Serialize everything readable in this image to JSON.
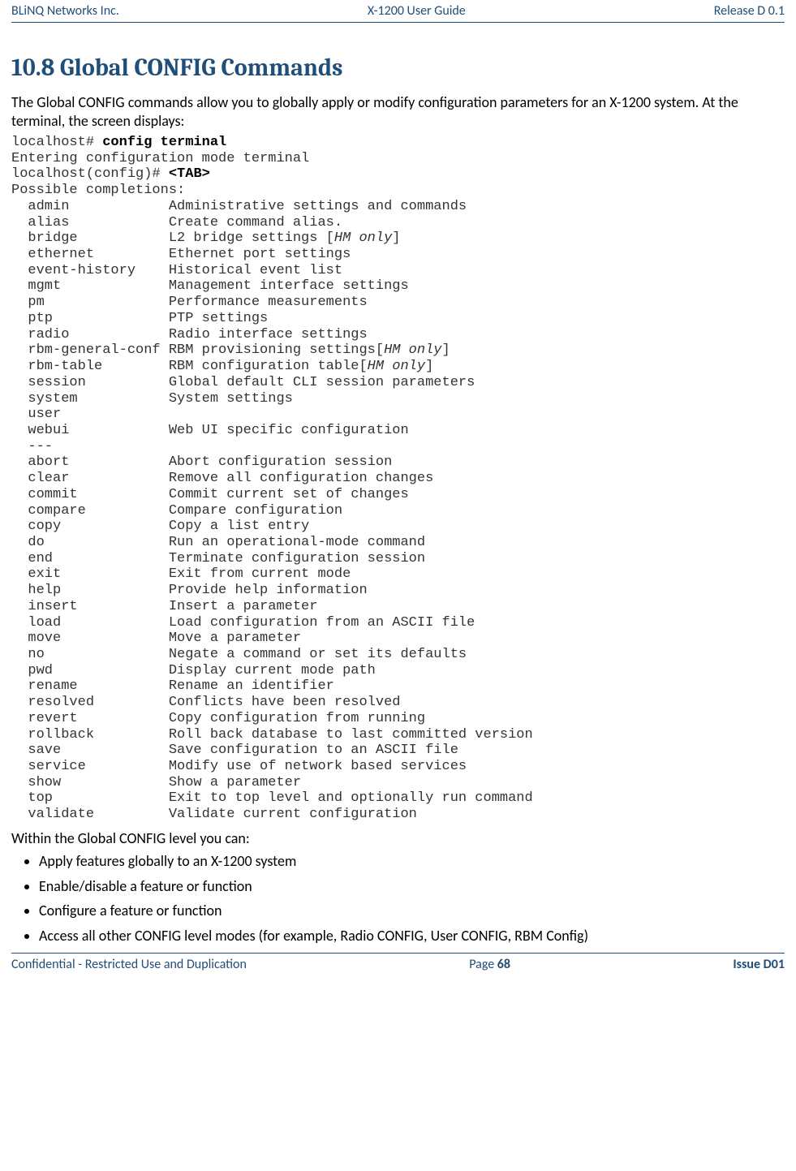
{
  "header": {
    "left": "BLiNQ Networks Inc.",
    "center": "X-1200 User Guide",
    "right": "Release D 0.1"
  },
  "section": {
    "title": "10.8 Global CONFIG Commands",
    "intro": "The Global CONFIG commands allow you to globally apply or modify configuration parameters for an X-1200 system. At the terminal, the screen displays:"
  },
  "terminal": {
    "line1_prefix": "localhost# ",
    "line1_bold": "config terminal",
    "line2": "Entering configuration mode terminal",
    "line3_prefix": "localhost(config)# ",
    "line3_bold": "<TAB>",
    "line4": "Possible completions:",
    "completions": [
      {
        "cmd": "admin",
        "desc": "Administrative settings and commands"
      },
      {
        "cmd": "alias",
        "desc": "Create command alias."
      },
      {
        "cmd": "bridge",
        "desc": "L2 bridge settings [",
        "italic": "HM only",
        "desc_after": "]"
      },
      {
        "cmd": "ethernet",
        "desc": "Ethernet port settings"
      },
      {
        "cmd": "event-history",
        "desc": "Historical event list"
      },
      {
        "cmd": "mgmt",
        "desc": "Management interface settings"
      },
      {
        "cmd": "pm",
        "desc": "Performance measurements"
      },
      {
        "cmd": "ptp",
        "desc": "PTP settings"
      },
      {
        "cmd": "radio",
        "desc": "Radio interface settings"
      },
      {
        "cmd": "rbm-general-conf",
        "desc": "RBM provisioning settings[",
        "italic": "HM only",
        "desc_after": "]",
        "tight": true
      },
      {
        "cmd": "rbm-table",
        "desc": "RBM configuration table[",
        "italic": "HM only",
        "desc_after": "]"
      },
      {
        "cmd": "session",
        "desc": "Global default CLI session parameters"
      },
      {
        "cmd": "system",
        "desc": "System settings"
      },
      {
        "cmd": "user",
        "desc": ""
      },
      {
        "cmd": "webui",
        "desc": "Web UI specific configuration"
      },
      {
        "cmd": "---",
        "desc": ""
      },
      {
        "cmd": "abort",
        "desc": "Abort configuration session"
      },
      {
        "cmd": "clear",
        "desc": "Remove all configuration changes"
      },
      {
        "cmd": "commit",
        "desc": "Commit current set of changes"
      },
      {
        "cmd": "compare",
        "desc": "Compare configuration"
      },
      {
        "cmd": "copy",
        "desc": "Copy a list entry"
      },
      {
        "cmd": "do",
        "desc": "Run an operational-mode command"
      },
      {
        "cmd": "end",
        "desc": "Terminate configuration session"
      },
      {
        "cmd": "exit",
        "desc": "Exit from current mode"
      },
      {
        "cmd": "help",
        "desc": "Provide help information"
      },
      {
        "cmd": "insert",
        "desc": "Insert a parameter"
      },
      {
        "cmd": "load",
        "desc": "Load configuration from an ASCII file"
      },
      {
        "cmd": "move",
        "desc": "Move a parameter"
      },
      {
        "cmd": "no",
        "desc": "Negate a command or set its defaults"
      },
      {
        "cmd": "pwd",
        "desc": "Display current mode path"
      },
      {
        "cmd": "rename",
        "desc": "Rename an identifier"
      },
      {
        "cmd": "resolved",
        "desc": "Conflicts have been resolved"
      },
      {
        "cmd": "revert",
        "desc": "Copy configuration from running"
      },
      {
        "cmd": "rollback",
        "desc": "Roll back database to last committed version"
      },
      {
        "cmd": "save",
        "desc": "Save configuration to an ASCII file"
      },
      {
        "cmd": "service",
        "desc": "Modify use of network based services"
      },
      {
        "cmd": "show",
        "desc": "Show a parameter"
      },
      {
        "cmd": "top",
        "desc": "Exit to top level and optionally run command"
      },
      {
        "cmd": "validate",
        "desc": "Validate current configuration"
      }
    ]
  },
  "followup": "Within the Global CONFIG level you can:",
  "bullets": [
    "Apply features globally to an X-1200 system",
    "Enable/disable a feature or function",
    "Configure a feature or function",
    "Access all other CONFIG level modes (for example, Radio CONFIG, User CONFIG, RBM Config)"
  ],
  "footer": {
    "left": "Confidential - Restricted Use and Duplication",
    "page_prefix": "Page ",
    "page_num": "68",
    "right": "Issue D01"
  }
}
